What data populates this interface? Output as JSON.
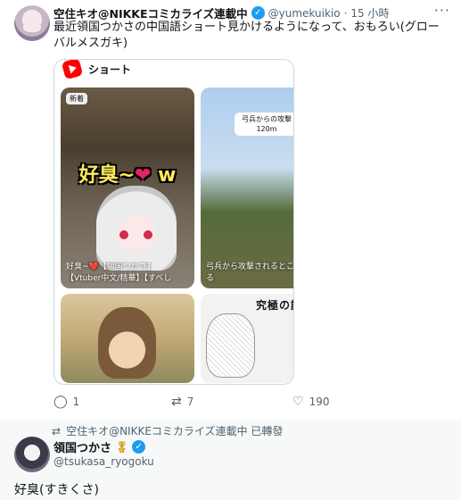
{
  "tweet": {
    "display_name": "空住キオ@NIKKEコミカライズ連載中",
    "verified_glyph": "✓",
    "handle": "@yumekuikio",
    "separator": "·",
    "time": "15 小時",
    "more_glyph": "···",
    "text": "最近領国つかさの中国語ショート見かけるようになって、おもろい(グローバルメスガキ)",
    "embed": {
      "title": "ショート",
      "cards": [
        {
          "badge": "新着",
          "overlay": "好臭~",
          "overlay_suffix": "w",
          "caption_line1": "好臭~❤️【領国つかさ】",
          "caption_line2": "【Vtuber中文/精華】【すべし"
        },
        {
          "pill_line1": "弓兵からの攻撃",
          "pill_line2": "120m",
          "caption_line1": "弓兵から攻撃されるとこ",
          "caption_line2": "る"
        },
        {},
        {
          "title": "究極の謎"
        }
      ]
    },
    "actions": {
      "reply_count": "1",
      "retweet_count": "7",
      "like_count": "190"
    }
  },
  "retweet_notice": {
    "text": "空住キオ@NIKKEコミカライズ連載中 已轉發"
  },
  "quoted": {
    "display_name": "領国つかさ",
    "verified_glyph": "✓",
    "handle": "@tsukasa_ryogoku",
    "text": "好臭(すきくさ)"
  },
  "colors": {
    "verified": "#1d9bf0",
    "shorts_red": "#ff0000",
    "muted": "#536471"
  },
  "icons": [
    "shorts-icon",
    "verified-icon",
    "reply-icon",
    "retweet-icon",
    "like-icon",
    "view-icon",
    "medal-icon"
  ]
}
